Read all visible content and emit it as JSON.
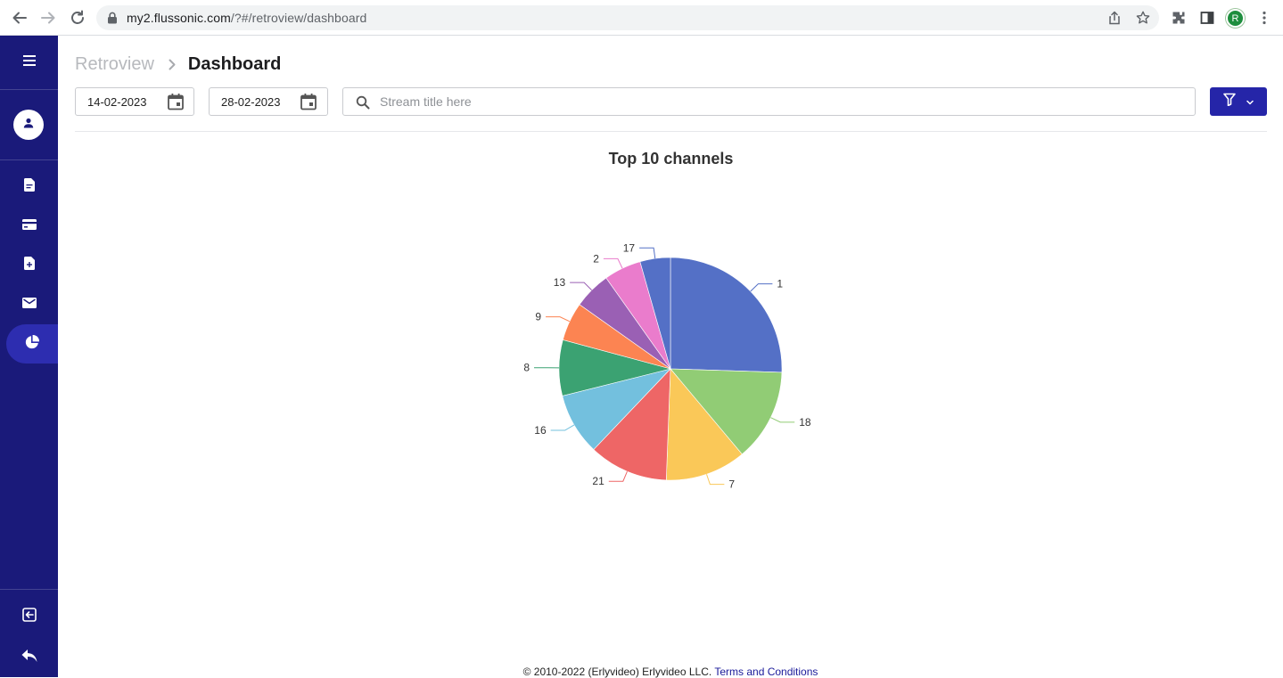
{
  "browser": {
    "url_host": "my2.flussonic.com",
    "url_path": "/?#/retroview/dashboard",
    "profile_initial": "R"
  },
  "breadcrumb": {
    "parent": "Retroview",
    "current": "Dashboard"
  },
  "filters": {
    "date_from": "14-02-2023",
    "date_to": "28-02-2023",
    "search_placeholder": "Stream title here"
  },
  "sidebar": {
    "items": [
      {
        "icon": "menu-icon"
      },
      {
        "icon": "user-icon"
      },
      {
        "icon": "document-icon"
      },
      {
        "icon": "card-icon"
      },
      {
        "icon": "file-add-icon"
      },
      {
        "icon": "mail-icon"
      },
      {
        "icon": "pie-chart-icon",
        "active": true
      },
      {
        "icon": "logout-icon"
      },
      {
        "icon": "reply-icon"
      }
    ]
  },
  "colors": {
    "sidebar": "#1a1a7a",
    "accent": "#2525a8"
  },
  "chart_data": {
    "type": "pie",
    "title": "Top 10 channels",
    "categories": [
      "1",
      "18",
      "7",
      "21",
      "16",
      "8",
      "9",
      "13",
      "2",
      "17"
    ],
    "values": [
      25.5,
      13.4,
      11.7,
      11.5,
      9.0,
      8.1,
      5.6,
      5.4,
      5.4,
      4.4
    ],
    "colors": [
      "#5470c6",
      "#91cc75",
      "#fac858",
      "#ee6666",
      "#73c0de",
      "#3ba272",
      "#fc8452",
      "#9a60b4",
      "#ea7ccc",
      "#5470c6"
    ]
  },
  "footer": {
    "copyright": "© 2010-2022 (Erlyvideo) Erlyvideo LLC.",
    "terms": "Terms and Conditions"
  }
}
